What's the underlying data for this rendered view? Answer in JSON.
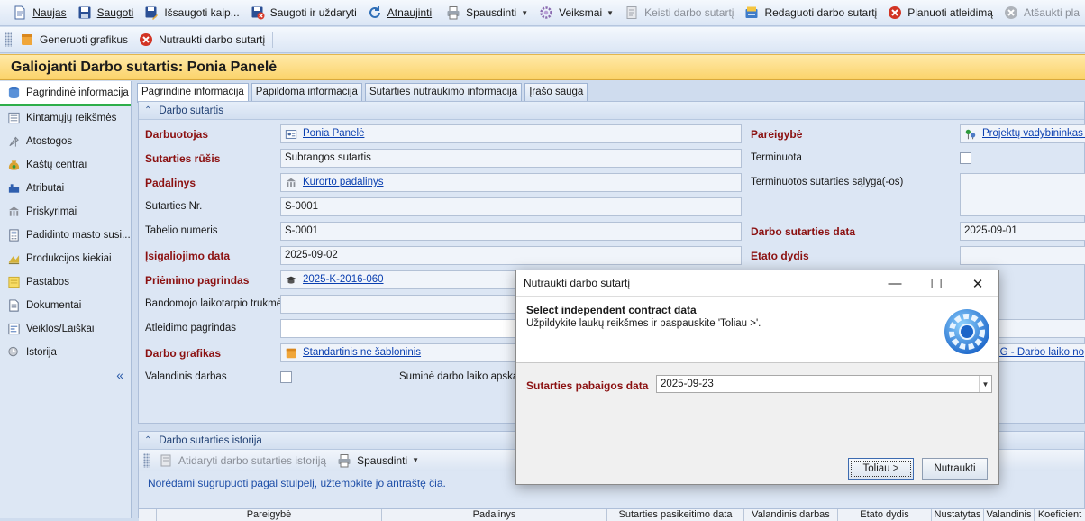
{
  "toolbar1": {
    "new": "Naujas",
    "save": "Saugoti",
    "save_as": "Išsaugoti kaip...",
    "save_close": "Saugoti ir uždaryti",
    "refresh": "Atnaujinti",
    "print": "Spausdinti",
    "actions": "Veiksmai",
    "change_contract": "Keisti darbo sutartį",
    "edit_contract": "Redaguoti darbo sutartį",
    "plan_dismissal": "Planuoti atleidimą",
    "recall_plan": "Atšaukti pla"
  },
  "toolbar2": {
    "generate_schedule": "Generuoti grafikus",
    "terminate_contract": "Nutraukti darbo sutartį"
  },
  "page_title": "Galiojanti Darbo sutartis: Ponia Panelė",
  "sidebar": {
    "items": [
      {
        "label": "Pagrindinė informacija"
      },
      {
        "label": "Kintamųjų reikšmės"
      },
      {
        "label": "Atostogos"
      },
      {
        "label": "Kaštų centrai"
      },
      {
        "label": "Atributai"
      },
      {
        "label": "Priskyrimai"
      },
      {
        "label": "Padidinto masto susi..."
      },
      {
        "label": "Produkcijos kiekiai"
      },
      {
        "label": "Pastabos"
      },
      {
        "label": "Dokumentai"
      },
      {
        "label": "Veiklos/Laiškai"
      },
      {
        "label": "Istorija"
      }
    ],
    "collapse": "«"
  },
  "tabs": [
    "Pagrindinė informacija",
    "Papildoma informacija",
    "Sutarties nutraukimo informacija",
    "Įrašo sauga"
  ],
  "group": {
    "title": "Darbo sutartis",
    "employee_label": "Darbuotojas",
    "employee_value": "Ponia Panelė",
    "contract_type_label": "Sutarties rūšis",
    "contract_type_value": "Subrangos sutartis",
    "division_label": "Padalinys",
    "division_value": "Kurorto padalinys",
    "contract_no_label": "Sutarties Nr.",
    "contract_no_value": "S-0001",
    "tabel_no_label": "Tabelio numeris",
    "tabel_no_value": "S-0001",
    "effective_date_label": "Įsigaliojimo data",
    "effective_date_value": "2025-09-02",
    "hire_basis_label": "Priėmimo pagrindas",
    "hire_basis_value": "2025-K-2016-060",
    "probation_label": "Bandomojo laikotarpio trukmė",
    "dismissal_basis_label": "Atleidimo pagrindas",
    "work_schedule_label": "Darbo grafikas",
    "work_schedule_value": "Standartinis ne šabloninis",
    "hourly_label": "Valandinis darbas",
    "summary_label": "Suminė darbo laiko apskaita",
    "position_label": "Pareigybė",
    "position_value": "Projektų vadybininkas (",
    "fixed_term_label": "Terminuota",
    "fixed_term_conditions_label": "Terminuotos sutarties sąlyga(-os)",
    "contract_date_label": "Darbo sutarties data",
    "contract_date_value": "2025-09-01",
    "fte_label": "Etato dydis",
    "right_link": "PG - Darbo laiko no"
  },
  "history": {
    "title": "Darbo sutarties istorija",
    "open_btn": "Atidaryti darbo sutarties istoriją",
    "print_btn": "Spausdinti",
    "hint": "Norėdami sugrupuoti pagal stulpelį, užtempkite jo antraštę čia.",
    "columns": [
      "Pareigybė",
      "Padalinys",
      "Sutarties pasikeitimo data",
      "Valandinis darbas",
      "Etato dydis",
      "Nustatytas",
      "Valandinis",
      "Koeficient"
    ]
  },
  "dialog": {
    "title": "Nutraukti darbo sutartį",
    "heading": "Select independent contract data",
    "subheading": "Užpildykite laukų reikšmes ir paspauskite 'Toliau >'.",
    "end_date_label": "Sutarties pabaigos data",
    "end_date_value": "2025-09-23",
    "next_btn": "Toliau >",
    "cancel_btn": "Nutraukti"
  }
}
